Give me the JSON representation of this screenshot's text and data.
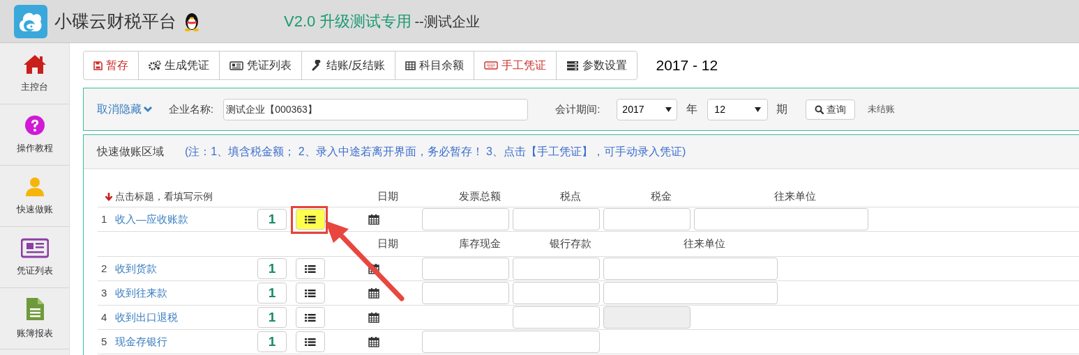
{
  "header": {
    "app_title": "小碟云财税平台",
    "version_label": "V2.0 升级测试专用",
    "company_suffix": "--测试企业"
  },
  "sidebar": {
    "items": [
      {
        "label": "主控台",
        "kind": "home"
      },
      {
        "label": "操作教程",
        "kind": "help"
      },
      {
        "label": "快速做账",
        "kind": "user"
      },
      {
        "label": "凭证列表",
        "kind": "news"
      },
      {
        "label": "账簿报表",
        "kind": "doc"
      }
    ]
  },
  "toolbar": {
    "buttons": [
      {
        "label": "暂存",
        "kind": "save",
        "accent": true
      },
      {
        "label": "生成凭证",
        "kind": "gears",
        "accent": false
      },
      {
        "label": "凭证列表",
        "kind": "news",
        "accent": false
      },
      {
        "label": "结账/反结账",
        "kind": "wrench",
        "accent": false
      },
      {
        "label": "科目余额",
        "kind": "table",
        "accent": false
      },
      {
        "label": "手工凭证",
        "kind": "keyboard",
        "accent": true
      },
      {
        "label": "参数设置",
        "kind": "server",
        "accent": false
      }
    ],
    "period": "2017 - 12"
  },
  "filter": {
    "toggle": "取消隐藏",
    "company_label": "企业名称:",
    "company_value": "测试企业【000363】",
    "period_label": "会计期间:",
    "year": "2017",
    "year_unit": "年",
    "month": "12",
    "month_unit": "期",
    "query_button": "查询",
    "status": "未结账"
  },
  "quick_entry": {
    "title": "快速做账区域",
    "note": "(注：1、填含税金额； 2、录入中途若离开界面，务必暂存！ 3、点击【手工凭证】，可手动录入凭证)",
    "sections": [
      {
        "hint": "点击标题，看填写示例",
        "headers": [
          {
            "label": "日期",
            "kind": "date"
          },
          {
            "label": "发票总额",
            "kind": "input"
          },
          {
            "label": "税点",
            "kind": "input"
          },
          {
            "label": "税金",
            "kind": "input"
          },
          {
            "label": "往来单位",
            "kind": "wide"
          }
        ],
        "rows": [
          {
            "number": "1",
            "title": "收入—应收账款",
            "count": "1",
            "highlighted": true,
            "fields": [
              {
                "kind": "input"
              },
              {
                "kind": "input"
              },
              {
                "kind": "input"
              },
              {
                "kind": "wide"
              }
            ]
          }
        ]
      },
      {
        "headers": [
          {
            "label": "日期",
            "kind": "date"
          },
          {
            "label": "库存现金",
            "kind": "input"
          },
          {
            "label": "银行存款",
            "kind": "input"
          },
          {
            "label": "往来单位",
            "kind": "wide"
          }
        ],
        "rows": [
          {
            "number": "2",
            "title": "收到货款",
            "count": "1",
            "highlighted": false,
            "fields": [
              {
                "kind": "input"
              },
              {
                "kind": "input"
              },
              {
                "kind": "wide"
              }
            ]
          },
          {
            "number": "3",
            "title": "收到往来款",
            "count": "1",
            "highlighted": false,
            "fields": [
              {
                "kind": "input"
              },
              {
                "kind": "input"
              },
              {
                "kind": "wide"
              }
            ]
          },
          {
            "number": "4",
            "title": "收到出口退税",
            "count": "1",
            "highlighted": false,
            "fields": [
              {
                "kind": "empty"
              },
              {
                "kind": "input"
              },
              {
                "kind": "disabled"
              }
            ]
          },
          {
            "number": "5",
            "title": "现金存银行",
            "count": "1",
            "highlighted": false,
            "fields": [
              {
                "kind": "double"
              }
            ]
          }
        ]
      }
    ]
  }
}
